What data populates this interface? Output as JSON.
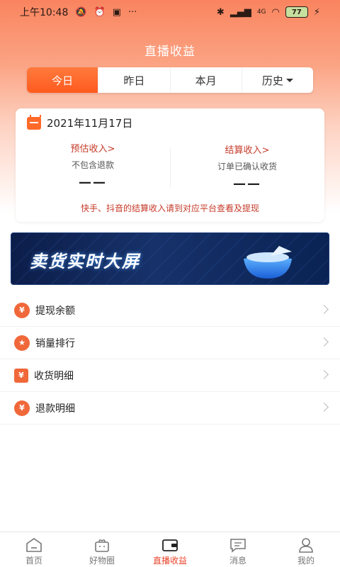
{
  "status_bar": {
    "time": "上午10:48",
    "signal_label": "4G",
    "battery": "77"
  },
  "header": {
    "title": "直播收益"
  },
  "tabs": [
    {
      "label": "今日",
      "active": true
    },
    {
      "label": "昨日",
      "active": false
    },
    {
      "label": "本月",
      "active": false
    },
    {
      "label": "历史",
      "active": false,
      "dropdown": true
    }
  ],
  "income_card": {
    "date": "2021年11月17日",
    "estimated": {
      "title": "预估收入>",
      "subtitle": "不包含退款",
      "value": "——"
    },
    "settled": {
      "title": "结算收入>",
      "subtitle": "订单已确认收货",
      "value": "——"
    },
    "note": "快手、抖音的结算收入请到对应平台查看及提现"
  },
  "banner": {
    "text": "卖货实时大屏"
  },
  "menu": [
    {
      "label": "提现余额",
      "icon": "money-bag-icon"
    },
    {
      "label": "销量排行",
      "icon": "medal-icon"
    },
    {
      "label": "收货明细",
      "icon": "receipt-icon"
    },
    {
      "label": "退款明细",
      "icon": "refund-icon"
    }
  ],
  "bottom_nav": [
    {
      "label": "首页",
      "icon": "home-icon",
      "active": false
    },
    {
      "label": "好物圈",
      "icon": "gift-icon",
      "active": false
    },
    {
      "label": "直播收益",
      "icon": "wallet-icon",
      "active": true
    },
    {
      "label": "消息",
      "icon": "message-icon",
      "active": false
    },
    {
      "label": "我的",
      "icon": "user-icon",
      "active": false
    }
  ],
  "colors": {
    "accent": "#ff5a1f",
    "alert_text": "#c63a2a",
    "nav_active": "#e8452b"
  }
}
